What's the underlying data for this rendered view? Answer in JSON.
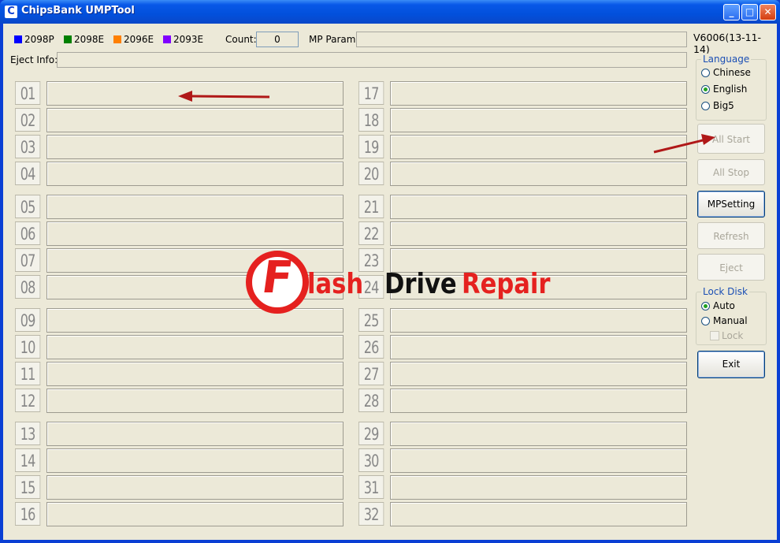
{
  "window": {
    "title": "ChipsBank UMPTool"
  },
  "legend": [
    {
      "label": "2098P",
      "color": "#0000ff"
    },
    {
      "label": "2098E",
      "color": "#008000"
    },
    {
      "label": "2096E",
      "color": "#ff8000"
    },
    {
      "label": "2093E",
      "color": "#8000ff"
    }
  ],
  "count": {
    "label": "Count:",
    "value": "0"
  },
  "mp_param": {
    "label": "MP Param:",
    "value": ""
  },
  "version": "V6006(13-11-14)",
  "eject_info": {
    "label": "Eject Info:",
    "value": ""
  },
  "slots_left": [
    "01",
    "02",
    "03",
    "04",
    "05",
    "06",
    "07",
    "08",
    "09",
    "10",
    "11",
    "12",
    "13",
    "14",
    "15",
    "16"
  ],
  "slots_right": [
    "17",
    "18",
    "19",
    "20",
    "21",
    "22",
    "23",
    "24",
    "25",
    "26",
    "27",
    "28",
    "29",
    "30",
    "31",
    "32"
  ],
  "language": {
    "title": "Language",
    "options": [
      "Chinese",
      "English",
      "Big5"
    ],
    "selected": "English"
  },
  "buttons": {
    "all_start": "All Start",
    "all_stop": "All Stop",
    "mpsetting": "MPSetting",
    "refresh": "Refresh",
    "eject": "Eject",
    "exit": "Exit"
  },
  "lock_disk": {
    "title": "Lock Disk",
    "options": [
      "Auto",
      "Manual"
    ],
    "selected": "Auto",
    "lock_label": "Lock"
  },
  "watermark": {
    "letter": "F",
    "word1": "lash",
    "word2": "Drive",
    "word3": "Repair"
  },
  "colors": {
    "watermark_red": "#e5211f",
    "arrow_red": "#b01818"
  }
}
